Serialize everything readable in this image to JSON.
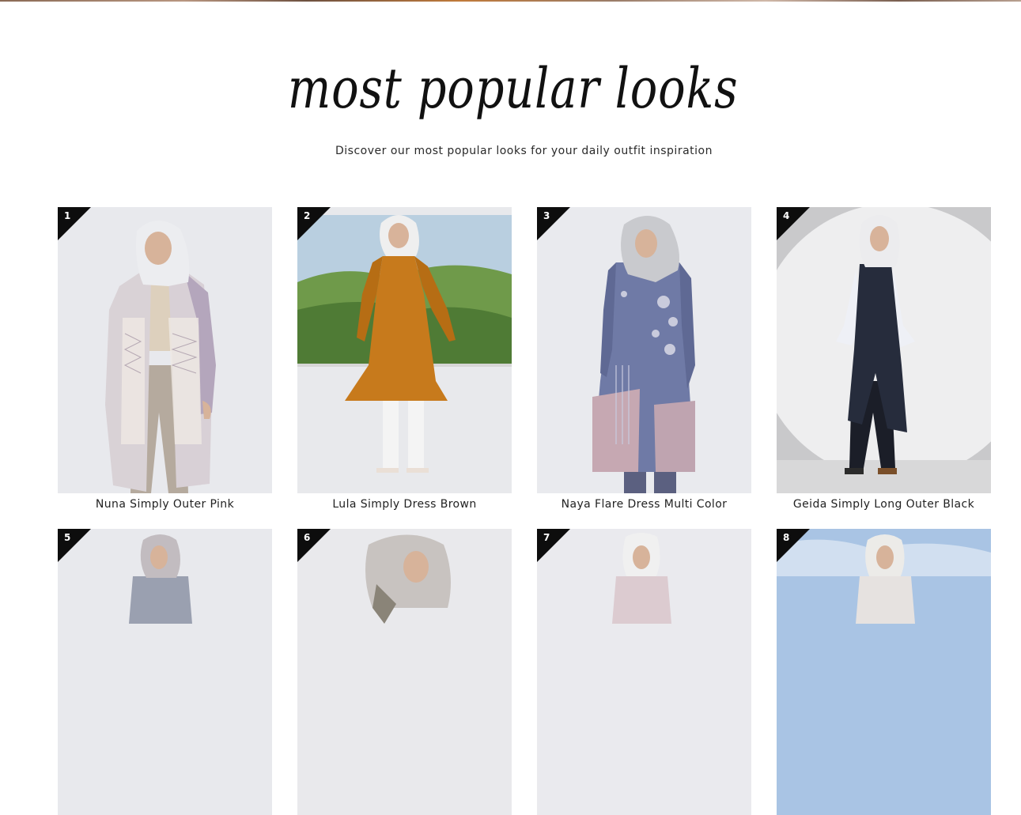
{
  "section": {
    "title": "most popular looks",
    "subtitle": "Discover our most popular looks for your daily outfit inspiration"
  },
  "products": [
    {
      "rank": "1",
      "name": "Nuna Simply Outer Pink"
    },
    {
      "rank": "2",
      "name": "Lula Simply Dress Brown"
    },
    {
      "rank": "3",
      "name": "Naya Flare Dress Multi Color"
    },
    {
      "rank": "4",
      "name": "Geida Simply Long Outer Black"
    },
    {
      "rank": "5",
      "name": ""
    },
    {
      "rank": "6",
      "name": ""
    },
    {
      "rank": "7",
      "name": ""
    },
    {
      "rank": "8",
      "name": ""
    }
  ],
  "colors": {
    "rank_badge": "#0d0d0d",
    "background": "#ffffff",
    "text": "#222222"
  }
}
